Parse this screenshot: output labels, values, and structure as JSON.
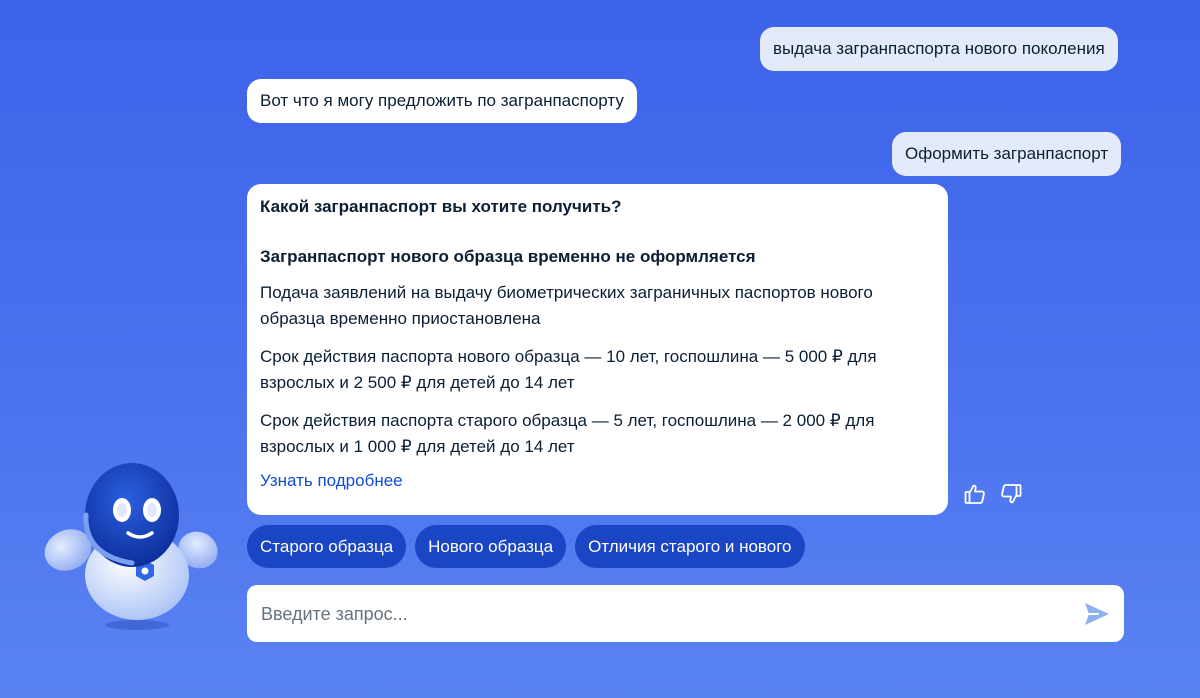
{
  "chat": {
    "user_message_1": "выдача загранпаспорта нового поколения",
    "bot_message_1": "Вот что я могу предложить по загранпаспорту",
    "user_message_2": "Оформить загранпаспорт"
  },
  "card": {
    "question": "Какой загранпаспорт вы хотите получить?",
    "notice_title": "Загранпаспорт нового образца временно не оформляется",
    "paragraph_1": "Подача заявлений на выдачу биометрических заграничных паспортов нового образца временно приостановлена",
    "paragraph_2": "Срок действия паспорта нового образца — 10 лет, госпошлина — 5 000 ₽ для взрослых и 2 500 ₽ для детей до 14 лет",
    "paragraph_3": "Срок действия паспорта старого образца — 5 лет, госпошлина — 2 000 ₽ для взрослых и 1 000 ₽ для детей до 14 лет",
    "more_link": "Узнать подробнее"
  },
  "reactions": {
    "like_icon": "thumbs-up-icon",
    "dislike_icon": "thumbs-down-icon"
  },
  "chips": [
    {
      "label": "Старого образца"
    },
    {
      "label": "Нового образца"
    },
    {
      "label": "Отличия старого и нового"
    }
  ],
  "input": {
    "placeholder": "Введите запрос...",
    "value": ""
  },
  "colors": {
    "background": "#3d63ea",
    "chip": "#1a45c4",
    "link": "#0d4cd3",
    "user_bubble": "#e3ebfb",
    "send_icon": "#8fb0ee"
  }
}
